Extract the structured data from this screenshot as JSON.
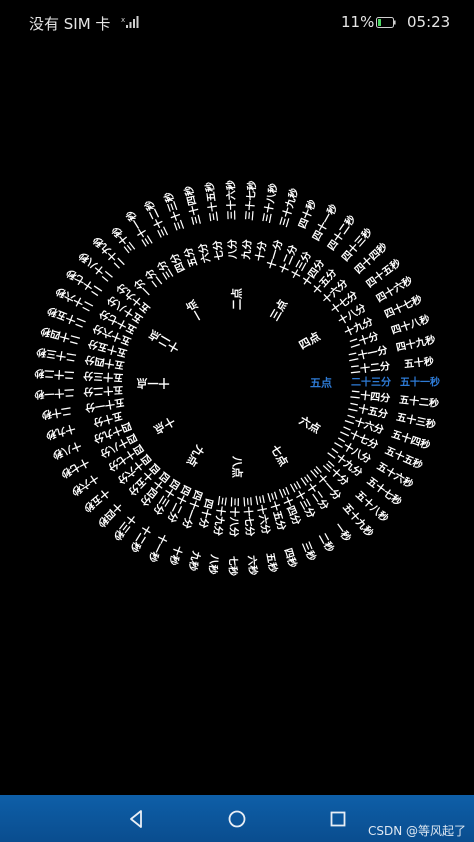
{
  "status_bar": {
    "carrier": "没有 SIM 卡",
    "battery_percent": "11%",
    "time": "05:23",
    "icons": [
      "signal-icon",
      "battery-icon"
    ]
  },
  "clock": {
    "hours": [
      "一点",
      "二点",
      "三点",
      "四点",
      "五点",
      "六点",
      "七点",
      "八点",
      "九点",
      "十点",
      "十一点",
      "十二点"
    ],
    "current_hour": "五点",
    "current_minute": "二十三分",
    "current_second": "五十一秒",
    "highlight_color": "#2e7bd6",
    "text_color": "#ffffff"
  },
  "nav_bar": {
    "buttons": [
      "back-icon",
      "home-icon",
      "recents-icon"
    ],
    "watermark": "CSDN @等风起了",
    "background": "#0e5fa8"
  }
}
